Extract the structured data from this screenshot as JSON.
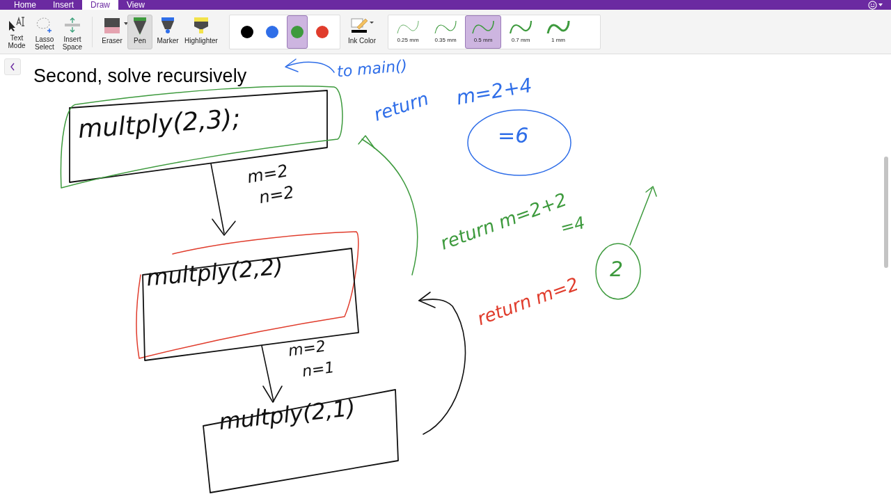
{
  "menu_tabs": [
    {
      "label": "Home",
      "selected": false
    },
    {
      "label": "Insert",
      "selected": false
    },
    {
      "label": "Draw",
      "selected": true
    },
    {
      "label": "View",
      "selected": false
    }
  ],
  "tools": [
    {
      "kind": "text",
      "label": "Text Mode",
      "selected": false
    },
    {
      "kind": "lasso",
      "label": "Lasso Select",
      "selected": false
    },
    {
      "kind": "space",
      "label": "Insert Space",
      "selected": false
    },
    {
      "kind": "eraser",
      "label": "Eraser",
      "selected": false
    },
    {
      "kind": "pen",
      "label": "Pen",
      "selected": true
    },
    {
      "kind": "marker",
      "label": "Marker",
      "selected": false
    },
    {
      "kind": "highlighter",
      "label": "Highlighter",
      "selected": false
    }
  ],
  "colors": [
    {
      "color": "#000000",
      "selected": false
    },
    {
      "color": "#2f6ee8",
      "selected": false
    },
    {
      "color": "#3d9a3d",
      "selected": true
    },
    {
      "color": "#e03c2c",
      "selected": false
    }
  ],
  "ink_color": {
    "label": "Ink Color"
  },
  "thicknesses": [
    {
      "label": "0.25 mm",
      "selected": false
    },
    {
      "label": "0.35 mm",
      "selected": false
    },
    {
      "label": "0.5 mm",
      "selected": true
    },
    {
      "label": "0.7 mm",
      "selected": false
    },
    {
      "label": "1 mm",
      "selected": false
    }
  ],
  "page": {
    "heading": "Second, solve recursively",
    "ink_notes": [
      {
        "text": "multply(2,3);",
        "color": "#111111"
      },
      {
        "text": "m=2",
        "color": "#111111"
      },
      {
        "text": "n=2",
        "color": "#111111"
      },
      {
        "text": "multply(2,2)",
        "color": "#111111"
      },
      {
        "text": "m=2",
        "color": "#111111"
      },
      {
        "text": "n=1",
        "color": "#111111"
      },
      {
        "text": "multply(2,1)",
        "color": "#111111"
      },
      {
        "text": "to main()",
        "color": "#2f6ee8"
      },
      {
        "text": "return",
        "color": "#2f6ee8"
      },
      {
        "text": "m=2+4",
        "color": "#2f6ee8"
      },
      {
        "text": "=6",
        "color": "#2f6ee8"
      },
      {
        "text": "return m=2+2",
        "color": "#3d9a3d"
      },
      {
        "text": "=4",
        "color": "#3d9a3d"
      },
      {
        "text": "2",
        "color": "#3d9a3d"
      },
      {
        "text": "return m=2",
        "color": "#e03c2c"
      }
    ]
  }
}
